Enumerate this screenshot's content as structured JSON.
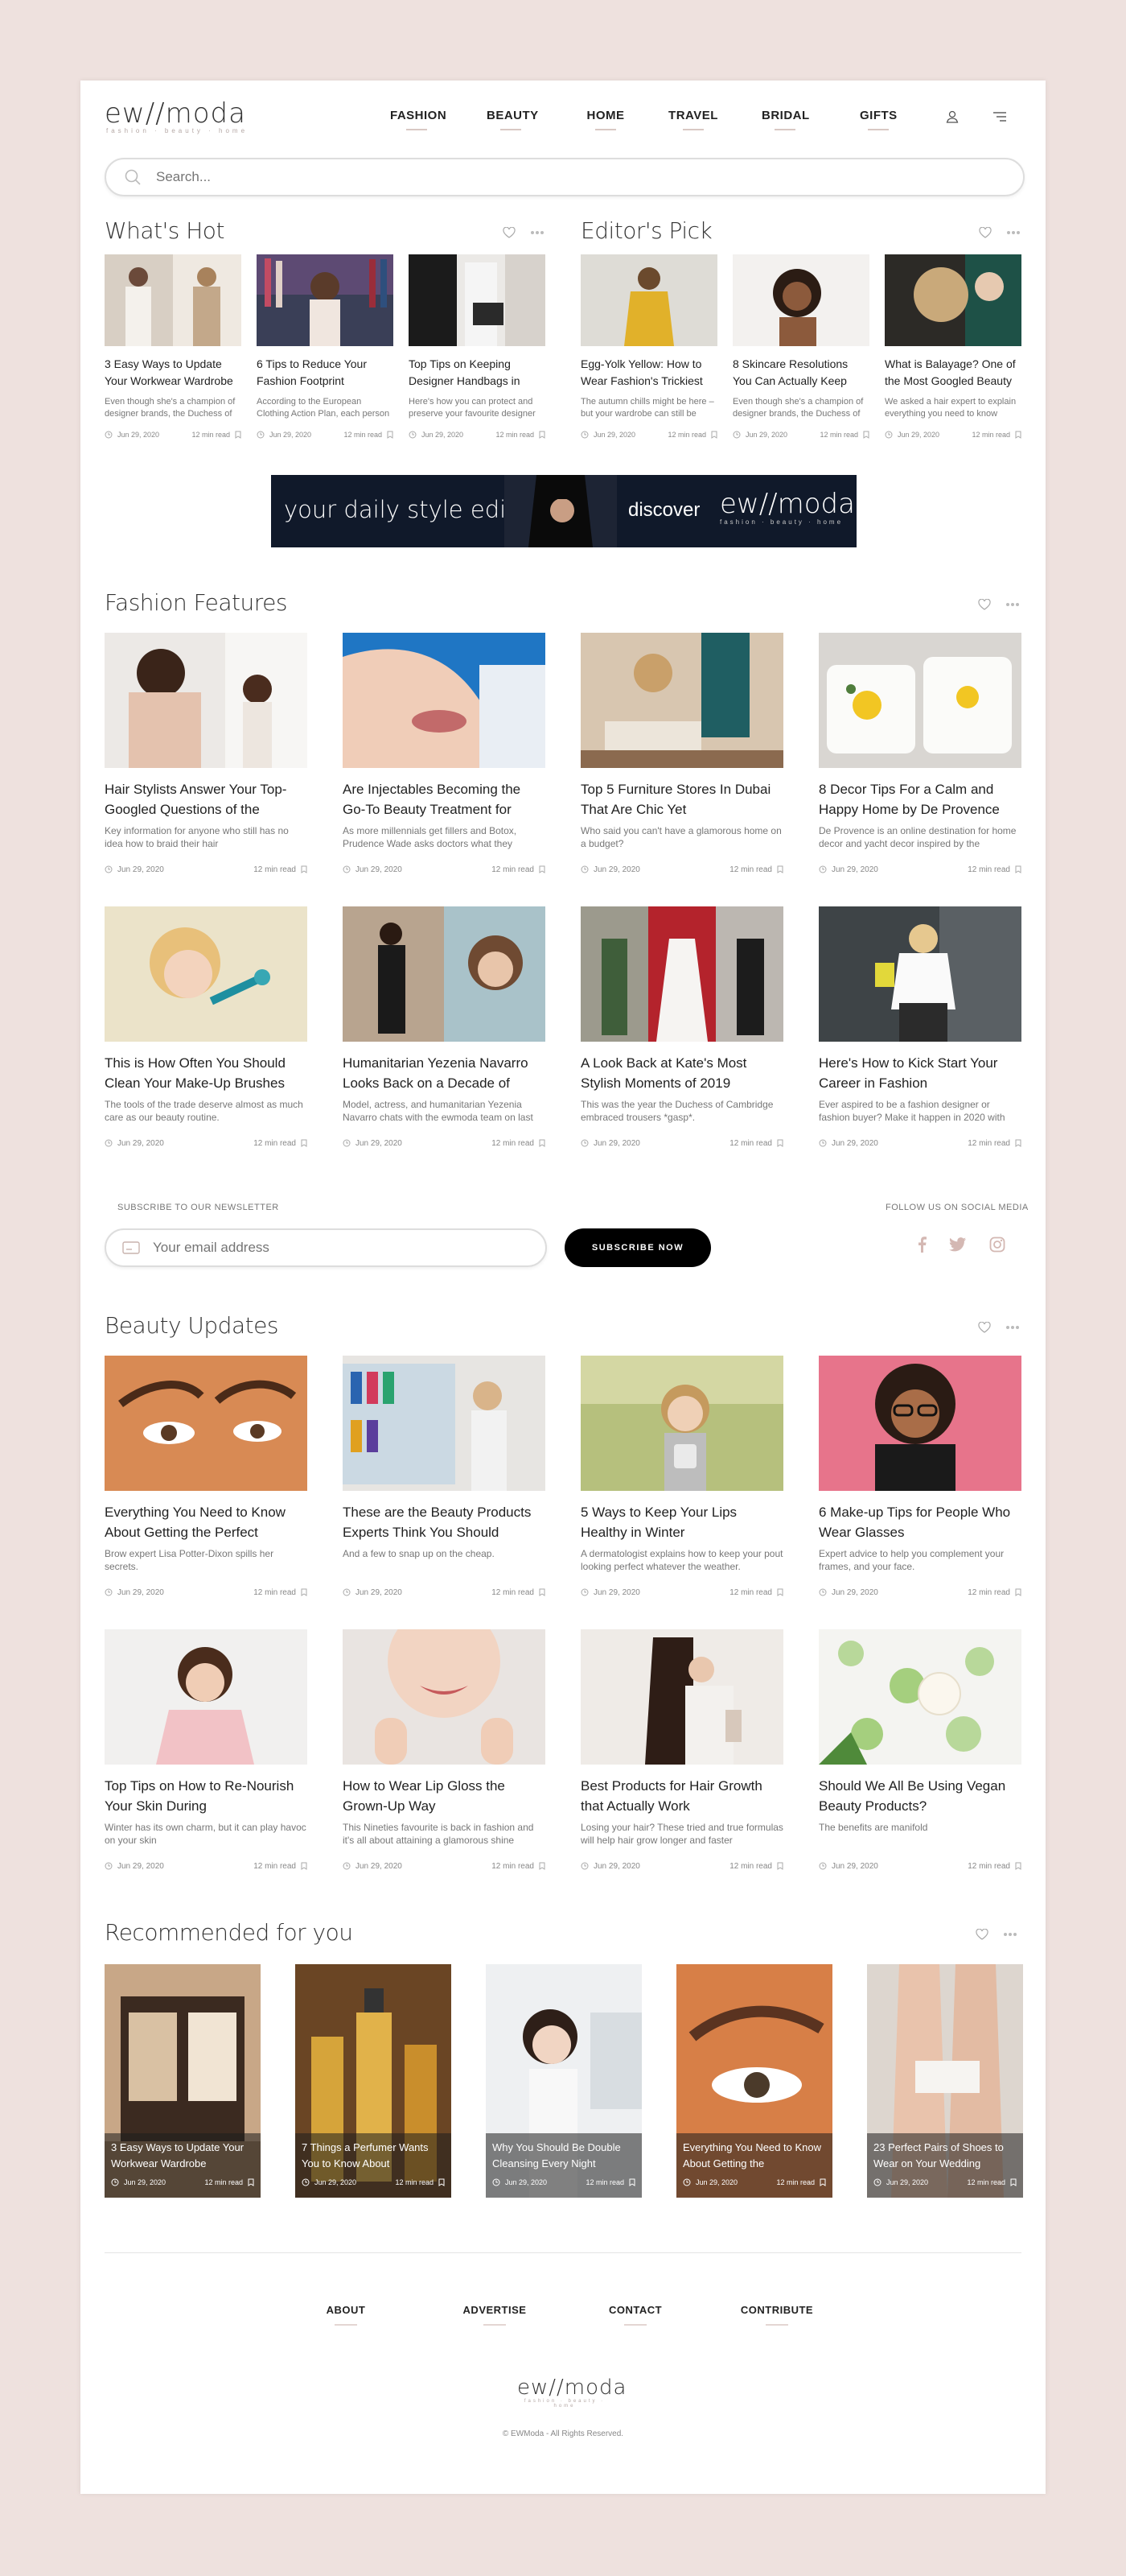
{
  "brand": {
    "name": "ew//moda",
    "tagline": "fashion · beauty · home"
  },
  "nav": [
    "FASHION",
    "BEAUTY",
    "HOME",
    "TRAVEL",
    "BRIDAL",
    "GIFTS"
  ],
  "search": {
    "placeholder": "Search..."
  },
  "whats_hot": {
    "title": "What's Hot",
    "cards": [
      {
        "title": "3 Easy Ways to Update Your Workwear Wardrobe",
        "excerpt": "Even though she's a champion of designer brands, the Duchess of",
        "date": "Jun 29, 2020",
        "read": "12 min read"
      },
      {
        "title": "6 Tips to Reduce Your Fashion Footprint",
        "excerpt": "According to the European Clothing Action Plan, each person",
        "date": "Jun 29, 2020",
        "read": "12 min read"
      },
      {
        "title": "Top Tips on Keeping Designer Handbags in",
        "excerpt": "Here's how you can protect and preserve your favourite designer",
        "date": "Jun 29, 2020",
        "read": "12 min read"
      }
    ]
  },
  "editors_pick": {
    "title": "Editor's Pick",
    "cards": [
      {
        "title": "Egg-Yolk Yellow: How to Wear Fashion's Trickiest",
        "excerpt": "The autumn chills might be here – but your wardrobe can still be",
        "date": "Jun 29, 2020",
        "read": "12 min read"
      },
      {
        "title": "8 Skincare Resolutions You Can Actually Keep",
        "excerpt": "Even though she's a champion of designer brands, the Duchess of",
        "date": "Jun 29, 2020",
        "read": "12 min read"
      },
      {
        "title": "What is Balayage? One of the Most Googled Beauty",
        "excerpt": "We asked a hair expert to explain everything you need to know",
        "date": "Jun 29, 2020",
        "read": "12 min read"
      }
    ]
  },
  "banner": {
    "left": "your daily style edit",
    "discover": "discover",
    "brand": "ew//moda",
    "tagline": "fashion · beauty · home"
  },
  "fashion_features": {
    "title": "Fashion Features",
    "cards": [
      {
        "title": "Hair Stylists Answer Your Top-Googled Questions of the",
        "excerpt": "Key information for anyone who still has no idea how to braid their hair",
        "date": "Jun 29, 2020",
        "read": "12 min read"
      },
      {
        "title": "Are Injectables Becoming the Go-To Beauty Treatment for",
        "excerpt": "As more millennials get fillers and Botox, Prudence Wade asks doctors what they",
        "date": "Jun 29, 2020",
        "read": "12 min read"
      },
      {
        "title": "Top 5 Furniture Stores In Dubai That Are Chic Yet",
        "excerpt": "Who said you can't have a glamorous home on a budget?",
        "date": "Jun 29, 2020",
        "read": "12 min read"
      },
      {
        "title": "8 Decor Tips For a Calm and Happy Home by De Provence",
        "excerpt": "De Provence is an online destination for home decor and yacht decor inspired by the",
        "date": "Jun 29, 2020",
        "read": "12 min read"
      },
      {
        "title": "This is How Often You Should Clean Your Make-Up Brushes",
        "excerpt": "The tools of the trade deserve almost as much care as our beauty routine.",
        "date": "Jun 29, 2020",
        "read": "12 min read"
      },
      {
        "title": "Humanitarian Yezenia Navarro Looks Back on a Decade of",
        "excerpt": "Model, actress, and humanitarian Yezenia Navarro chats with the ewmoda team on last",
        "date": "Jun 29, 2020",
        "read": "12 min read"
      },
      {
        "title": "A Look Back at Kate's Most Stylish Moments of 2019",
        "excerpt": "This was the year the Duchess of Cambridge embraced trousers *gasp*.",
        "date": "Jun 29, 2020",
        "read": "12 min read"
      },
      {
        "title": "Here's How to Kick Start Your Career in Fashion",
        "excerpt": "Ever aspired to be a fashion designer or fashion buyer? Make it happen in 2020 with",
        "date": "Jun 29, 2020",
        "read": "12 min read"
      }
    ]
  },
  "newsletter": {
    "label": "SUBSCRIBE TO OUR NEWSLETTER",
    "placeholder": "Your email address",
    "button": "SUBSCRIBE NOW",
    "social_label": "FOLLOW US ON SOCIAL MEDIA"
  },
  "beauty_updates": {
    "title": "Beauty Updates",
    "cards": [
      {
        "title": "Everything You Need to Know About Getting the Perfect",
        "excerpt": "Brow expert Lisa Potter-Dixon spills her secrets.",
        "date": "Jun 29, 2020",
        "read": "12 min read"
      },
      {
        "title": "These are the Beauty Products Experts Think You Should",
        "excerpt": "And a few to snap up on the cheap.",
        "date": "Jun 29, 2020",
        "read": "12 min read"
      },
      {
        "title": "5 Ways to Keep Your Lips Healthy in Winter",
        "excerpt": "A dermatologist explains how to keep your pout looking perfect whatever the weather.",
        "date": "Jun 29, 2020",
        "read": "12 min read"
      },
      {
        "title": "6 Make-up Tips for People Who Wear Glasses",
        "excerpt": "Expert advice to help you complement your frames, and your face.",
        "date": "Jun 29, 2020",
        "read": "12 min read"
      },
      {
        "title": "Top Tips on How to Re-Nourish Your Skin During",
        "excerpt": "Winter has its own charm, but it can play havoc on your skin",
        "date": "Jun 29, 2020",
        "read": "12 min read"
      },
      {
        "title": "How to Wear Lip Gloss the Grown-Up Way",
        "excerpt": "This Nineties favourite is back in fashion and it's all about attaining a glamorous shine",
        "date": "Jun 29, 2020",
        "read": "12 min read"
      },
      {
        "title": "Best Products for Hair Growth that Actually Work",
        "excerpt": "Losing your hair? These tried and true formulas will help hair grow longer and faster",
        "date": "Jun 29, 2020",
        "read": "12 min read"
      },
      {
        "title": "Should We All Be Using Vegan Beauty Products?",
        "excerpt": "The benefits are manifold",
        "date": "Jun 29, 2020",
        "read": "12 min read"
      }
    ]
  },
  "recommended": {
    "title": "Recommended for you",
    "cards": [
      {
        "title": "3 Easy Ways to Update Your Workwear Wardrobe",
        "date": "Jun 29, 2020",
        "read": "12 min read"
      },
      {
        "title": "7 Things a Perfumer Wants You to Know About",
        "date": "Jun 29, 2020",
        "read": "12 min read"
      },
      {
        "title": "Why You Should Be Double Cleansing Every Night",
        "date": "Jun 29, 2020",
        "read": "12 min read"
      },
      {
        "title": "Everything You Need to Know About Getting the",
        "date": "Jun 29, 2020",
        "read": "12 min read"
      },
      {
        "title": "23 Perfect Pairs of Shoes to Wear on Your Wedding",
        "date": "Jun 29, 2020",
        "read": "12 min read"
      }
    ]
  },
  "footer": {
    "links": [
      "ABOUT",
      "ADVERTISE",
      "CONTACT",
      "CONTRIBUTE"
    ],
    "copyright": "© EWModa - All Rights Reserved."
  },
  "colors": {
    "background": "#eee1de",
    "accent": "#d9c8c4",
    "button": "#000000",
    "banner": "#10192a"
  }
}
